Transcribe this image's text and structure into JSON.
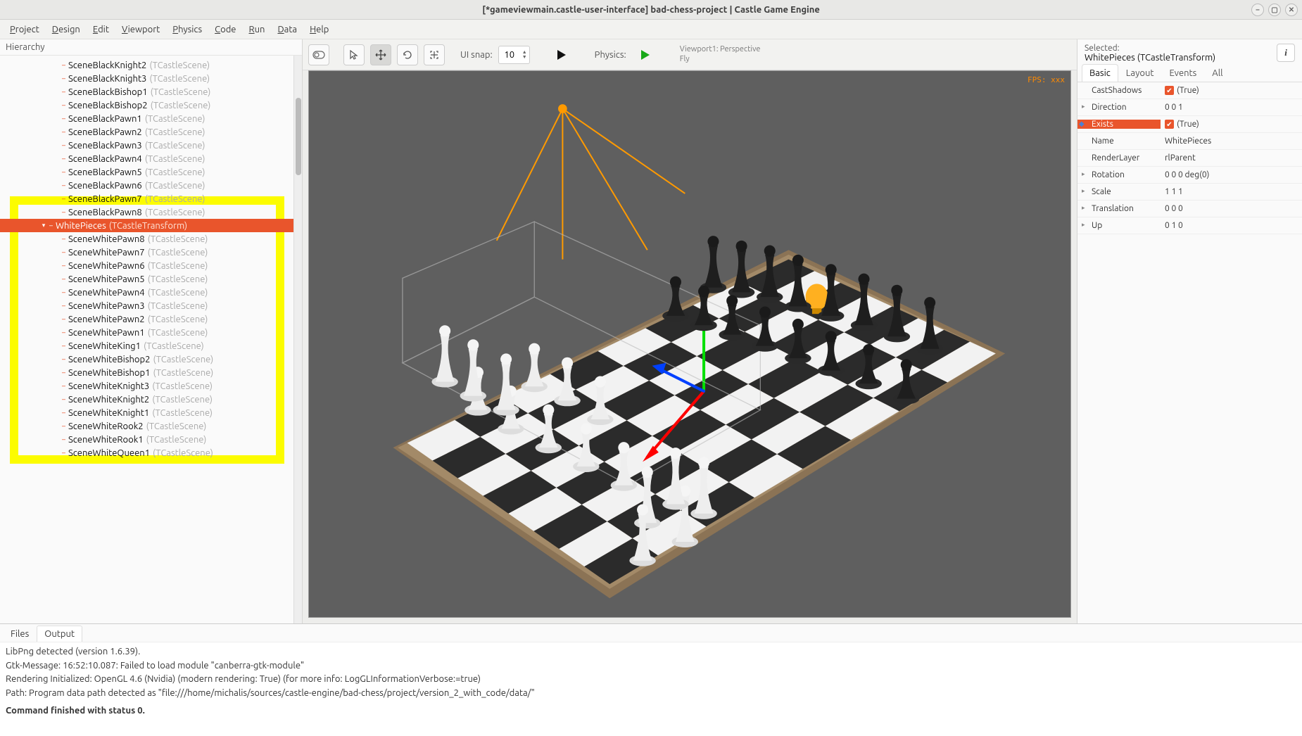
{
  "window": {
    "title": "[*gameviewmain.castle-user-interface] bad-chess-project | Castle Game Engine"
  },
  "menubar": [
    "Project",
    "Design",
    "Edit",
    "Viewport",
    "Physics",
    "Code",
    "Run",
    "Data",
    "Help"
  ],
  "hierarchy": {
    "title": "Hierarchy",
    "items": [
      {
        "depth": 3,
        "name": "SceneBlackKnight2",
        "type": "(TCastleScene)"
      },
      {
        "depth": 3,
        "name": "SceneBlackKnight3",
        "type": "(TCastleScene)"
      },
      {
        "depth": 3,
        "name": "SceneBlackBishop1",
        "type": "(TCastleScene)"
      },
      {
        "depth": 3,
        "name": "SceneBlackBishop2",
        "type": "(TCastleScene)"
      },
      {
        "depth": 3,
        "name": "SceneBlackPawn1",
        "type": "(TCastleScene)"
      },
      {
        "depth": 3,
        "name": "SceneBlackPawn2",
        "type": "(TCastleScene)"
      },
      {
        "depth": 3,
        "name": "SceneBlackPawn3",
        "type": "(TCastleScene)"
      },
      {
        "depth": 3,
        "name": "SceneBlackPawn4",
        "type": "(TCastleScene)"
      },
      {
        "depth": 3,
        "name": "SceneBlackPawn5",
        "type": "(TCastleScene)"
      },
      {
        "depth": 3,
        "name": "SceneBlackPawn6",
        "type": "(TCastleScene)"
      },
      {
        "depth": 3,
        "name": "SceneBlackPawn7",
        "type": "(TCastleScene)"
      },
      {
        "depth": 3,
        "name": "SceneBlackPawn8",
        "type": "(TCastleScene)"
      },
      {
        "depth": 2,
        "name": "WhitePieces",
        "type": "(TCastleTransform)",
        "selected": true,
        "expanded": true
      },
      {
        "depth": 3,
        "name": "SceneWhitePawn8",
        "type": "(TCastleScene)"
      },
      {
        "depth": 3,
        "name": "SceneWhitePawn7",
        "type": "(TCastleScene)"
      },
      {
        "depth": 3,
        "name": "SceneWhitePawn6",
        "type": "(TCastleScene)"
      },
      {
        "depth": 3,
        "name": "SceneWhitePawn5",
        "type": "(TCastleScene)"
      },
      {
        "depth": 3,
        "name": "SceneWhitePawn4",
        "type": "(TCastleScene)"
      },
      {
        "depth": 3,
        "name": "SceneWhitePawn3",
        "type": "(TCastleScene)"
      },
      {
        "depth": 3,
        "name": "SceneWhitePawn2",
        "type": "(TCastleScene)"
      },
      {
        "depth": 3,
        "name": "SceneWhitePawn1",
        "type": "(TCastleScene)"
      },
      {
        "depth": 3,
        "name": "SceneWhiteKing1",
        "type": "(TCastleScene)"
      },
      {
        "depth": 3,
        "name": "SceneWhiteBishop2",
        "type": "(TCastleScene)"
      },
      {
        "depth": 3,
        "name": "SceneWhiteBishop1",
        "type": "(TCastleScene)"
      },
      {
        "depth": 3,
        "name": "SceneWhiteKnight3",
        "type": "(TCastleScene)"
      },
      {
        "depth": 3,
        "name": "SceneWhiteKnight2",
        "type": "(TCastleScene)"
      },
      {
        "depth": 3,
        "name": "SceneWhiteKnight1",
        "type": "(TCastleScene)"
      },
      {
        "depth": 3,
        "name": "SceneWhiteRook2",
        "type": "(TCastleScene)"
      },
      {
        "depth": 3,
        "name": "SceneWhiteRook1",
        "type": "(TCastleScene)"
      },
      {
        "depth": 3,
        "name": "SceneWhiteQueen1",
        "type": "(TCastleScene)"
      }
    ]
  },
  "toolbar": {
    "uisnap_label": "UI snap:",
    "uisnap_value": "10",
    "physics_label": "Physics:",
    "viewport_info_line1": "Viewport1: Perspective",
    "viewport_info_line2": "Fly"
  },
  "viewport": {
    "fps": "FPS: xxx"
  },
  "inspector": {
    "selected_label": "Selected:",
    "selected_value": "WhitePieces (TCastleTransform)",
    "tabs": [
      "Basic",
      "Layout",
      "Events",
      "All"
    ],
    "properties": [
      {
        "key": "CastShadows",
        "value": "(True)",
        "check": true
      },
      {
        "key": "Direction",
        "value": "0 0 1",
        "expand": true
      },
      {
        "key": "Exists",
        "value": "(True)",
        "check": true,
        "highlight": true,
        "arrow": true
      },
      {
        "key": "Name",
        "value": "WhitePieces"
      },
      {
        "key": "RenderLayer",
        "value": "rlParent"
      },
      {
        "key": "Rotation",
        "value": "0 0 0 deg(0)",
        "expand": true
      },
      {
        "key": "Scale",
        "value": "1 1 1",
        "expand": true
      },
      {
        "key": "Translation",
        "value": "0 0 0",
        "expand": true
      },
      {
        "key": "Up",
        "value": "0 1 0",
        "expand": true
      }
    ]
  },
  "bottom": {
    "tabs": [
      "Files",
      "Output"
    ],
    "lines": [
      "LibPng detected (version 1.6.39).",
      "Gtk-Message: 16:52:10.087: Failed to load module \"canberra-gtk-module\"",
      "Rendering Initialized: OpenGL 4.6 (Nvidia) (modern rendering: True) (for more info: LogGLInformationVerbose:=true)",
      "Path: Program data path detected as \"file:///home/michalis/sources/castle-engine/bad-chess/project/version_2_with_code/data/\""
    ],
    "status": "Command finished with status 0."
  }
}
